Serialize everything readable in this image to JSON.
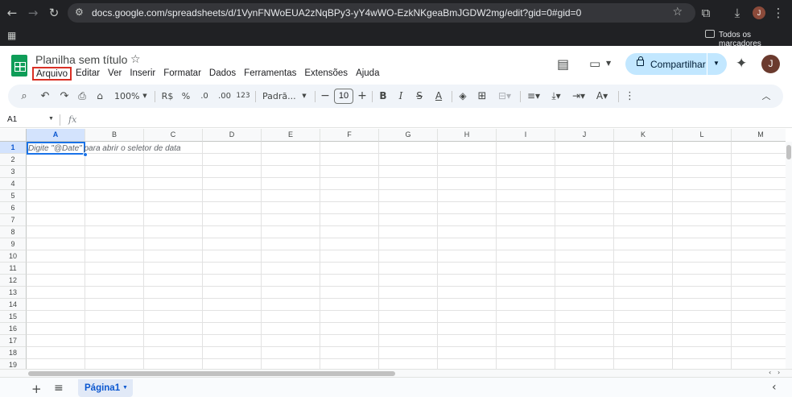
{
  "browser": {
    "url": "docs.google.com/spreadsheets/d/1VynFNWoEUA2zNqBPy3-yY4wWO-EzkNKgeaBmJGDW2mg/edit?gid=0#gid=0",
    "profile_initial": "J",
    "bookmarks_label": "Todos os marcadores"
  },
  "doc": {
    "title": "Planilha sem título",
    "menu": [
      "Arquivo",
      "Editar",
      "Ver",
      "Inserir",
      "Formatar",
      "Dados",
      "Ferramentas",
      "Extensões",
      "Ajuda"
    ],
    "highlighted_menu": "Arquivo",
    "share_label": "Compartilhar",
    "user_initial": "J"
  },
  "toolbar": {
    "zoom": "100%",
    "currency": "R$",
    "percent": "%",
    "dec_less": ".0",
    "dec_more": ".00",
    "number_format": "123",
    "font": "Padrã...",
    "font_size": "10",
    "bold": "B",
    "italic": "I"
  },
  "formula_bar": {
    "cell_ref": "A1",
    "fx": "fx"
  },
  "grid": {
    "columns": [
      "A",
      "B",
      "C",
      "D",
      "E",
      "F",
      "G",
      "H",
      "I",
      "J",
      "K",
      "L",
      "M"
    ],
    "rows": [
      "1",
      "2",
      "3",
      "4",
      "5",
      "6",
      "7",
      "8",
      "9",
      "10",
      "11",
      "12",
      "13",
      "14",
      "15",
      "16",
      "17",
      "18",
      "19"
    ],
    "selected_col": "A",
    "selected_row": "1",
    "cell_hint": "Digite \"@Date\" para abrir o seletor de data"
  },
  "sheet_tabs": {
    "active": "Página1"
  },
  "colors": {
    "accent": "#1a73e8",
    "highlight_box": "#d93025",
    "share_bg": "#c2e7ff",
    "sheets_green": "#0f9d58"
  }
}
